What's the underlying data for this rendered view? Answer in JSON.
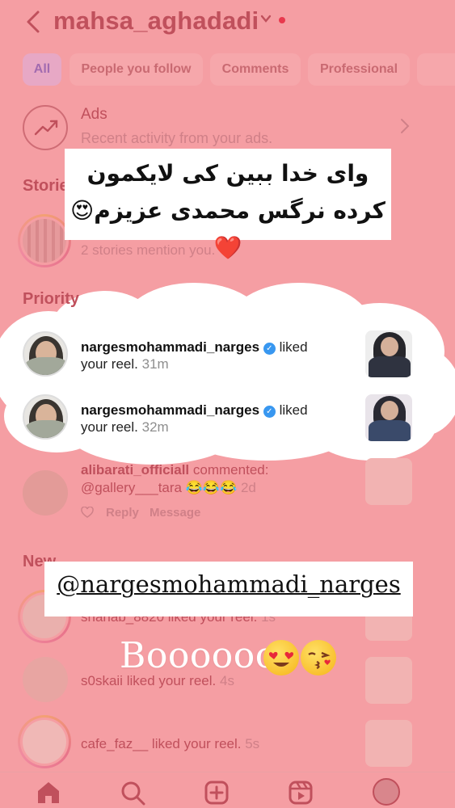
{
  "header": {
    "back_icon": "chevron-left-icon",
    "username": "mahsa_aghadadi",
    "dropdown_icon": "chevron-down-icon"
  },
  "filters": [
    "All",
    "People you follow",
    "Comments",
    "Professional"
  ],
  "ads": {
    "title": "Ads",
    "subtitle": "Recent activity from your ads."
  },
  "stories": {
    "heading": "Stories",
    "subtitle": "2 stories mention you."
  },
  "quote": {
    "text": "وای خدا ببین کی لایکمون کرده نرگس محمدی عزیزم😍❤️"
  },
  "priority": {
    "heading": "Priority",
    "items": [
      {
        "user": "nargesmohammadi_narges",
        "action": "liked",
        "line2": "your reel.",
        "time": "31m"
      },
      {
        "user": "nargesmohammadi_narges",
        "action": "liked",
        "line2": "your reel.",
        "time": "32m"
      },
      {
        "user": "alibarati_officiall",
        "action": "commented:",
        "line2": "@gallery___tara 😂😂😂",
        "time": "2d",
        "reply": "Reply",
        "message": "Message"
      }
    ]
  },
  "new": {
    "heading": "New",
    "items": [
      {
        "user": "shahab_8820",
        "action": "liked your reel.",
        "time": "1s"
      },
      {
        "user": "s0skaii",
        "action": "liked your reel.",
        "time": "4s"
      },
      {
        "user": "cafe_faz__",
        "action": "liked your reel.",
        "time": "5s"
      }
    ]
  },
  "mention": {
    "text": "@nargesmohammadi_narges"
  },
  "caption": {
    "text": "Boooooos"
  },
  "nav": [
    "home-icon",
    "search-icon",
    "create-icon",
    "reels-icon",
    "profile-avatar"
  ]
}
